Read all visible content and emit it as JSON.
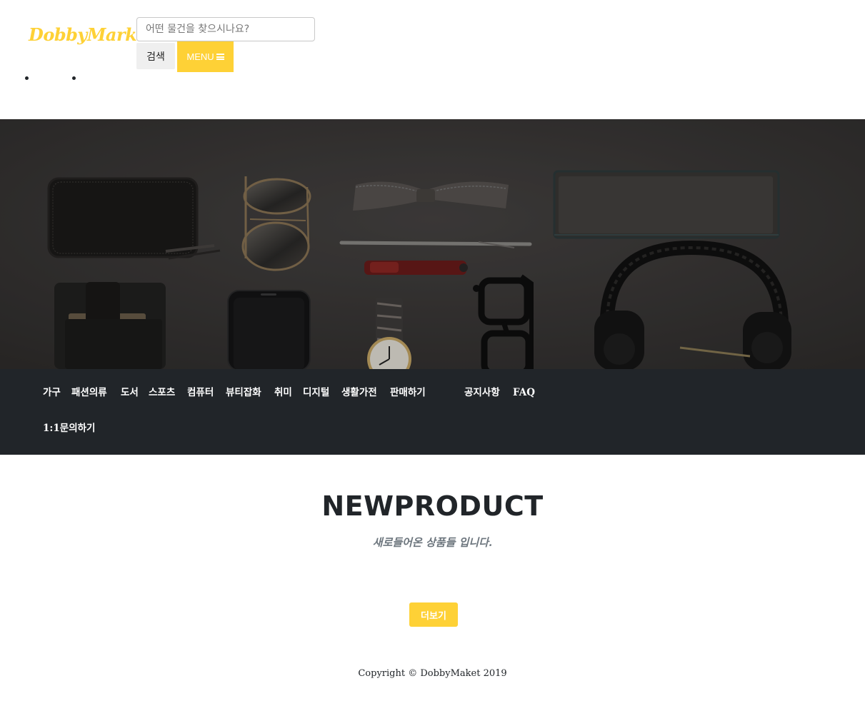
{
  "header": {
    "brand": "DobbyMarket",
    "search": {
      "placeholder": "어떤 물건을 찾으시나요?",
      "value": ""
    },
    "search_button_label": "검색",
    "menu_button_label": "MENU"
  },
  "hero": {
    "items": [
      "wallet",
      "sunglasses",
      "bow-tie",
      "notebook",
      "pen",
      "lighter",
      "card-wallet",
      "smartphone",
      "wristwatch",
      "eyeglasses",
      "headphones"
    ]
  },
  "nav": {
    "categories": [
      "가구",
      "패션의류",
      "도서",
      "스포츠",
      "컴퓨터",
      "뷰티잡화",
      "취미",
      "디지털",
      "생활가전",
      "판매하기"
    ],
    "links": [
      "공지사항",
      "FAQ",
      "1:1문의하기"
    ]
  },
  "section": {
    "heading": "NEWPRODUCT",
    "subheading": "새로들어온 상품들 입니다.",
    "more_button": "더보기"
  },
  "footer": {
    "copyright": "Copyright © DobbyMaket 2019"
  },
  "colors": {
    "accent": "#fed136",
    "nav_background": "#212529",
    "hero_background": "#3a3837",
    "text": "#212529",
    "muted": "#6c757d"
  }
}
